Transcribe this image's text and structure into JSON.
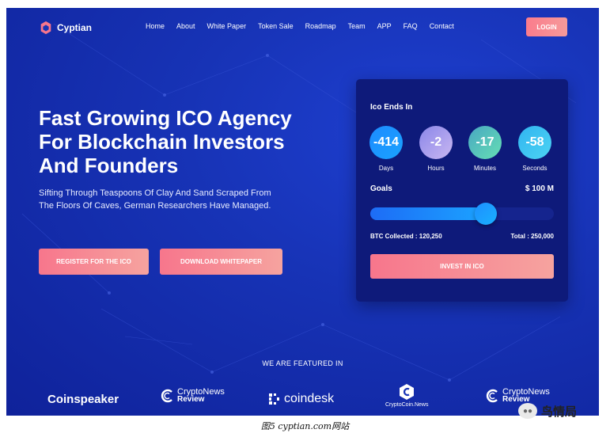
{
  "brand": {
    "name": "Cyptian",
    "accent": "#f7768c",
    "bg": "#1733b6"
  },
  "nav": {
    "items": [
      "Home",
      "About",
      "White Paper",
      "Token Sale",
      "Roadmap",
      "Team",
      "APP",
      "FAQ",
      "Contact"
    ],
    "login_label": "LOGIN"
  },
  "hero": {
    "title": "Fast Growing ICO Agency For Blockchain Investors And Founders",
    "subtitle": "Sifting Through Teaspoons Of Clay And Sand Scraped From The Floors Of Caves, German Researchers Have Managed.",
    "register_label": "REGISTER FOR THE ICO",
    "download_label": "DOWNLOAD WHITEPAPER"
  },
  "ico": {
    "title": "Ico Ends In",
    "timers": [
      {
        "value": "-414",
        "label": "Days"
      },
      {
        "value": "-2",
        "label": "Hours"
      },
      {
        "value": "-17",
        "label": "Minutes"
      },
      {
        "value": "-58",
        "label": "Seconds"
      }
    ],
    "goals_label": "Goals",
    "goals_value": "$ 100 M",
    "progress": 0.63,
    "collected": "BTC Collected : 120,250",
    "total": "Total : 250,000",
    "invest_label": "INVEST IN ICO"
  },
  "featured": {
    "title": "WE ARE FEATURED IN",
    "logos": {
      "coinspeaker": "Coinspeaker",
      "cryptonews_a": "CryptoNews",
      "cryptonews_b": "Review",
      "coindesk": "coindesk",
      "cryptocoin": "CryptoCoin.News",
      "cryptonews2_a": "CryptoNews",
      "cryptonews2_b": "Review"
    }
  },
  "caption": "图5 cyptian.com网站",
  "watermark": "鸟情局"
}
